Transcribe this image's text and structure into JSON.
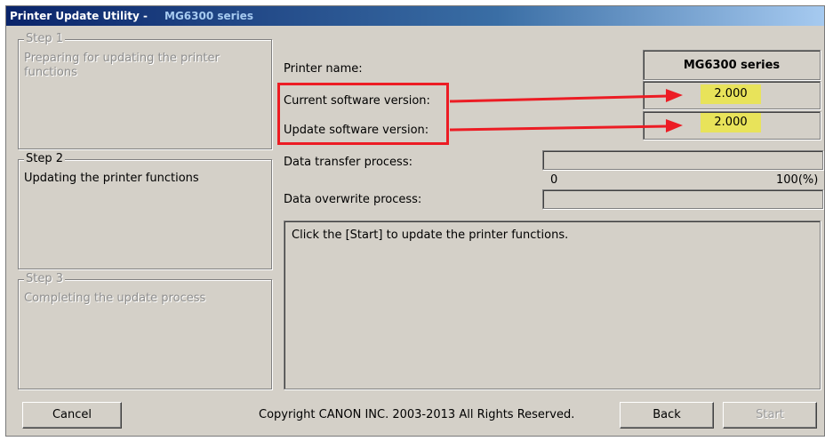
{
  "window": {
    "title": "Printer Update Utility -",
    "title_series": "MG6300 series"
  },
  "steps": [
    {
      "title": "Step 1",
      "desc": "Preparing for updating the printer functions",
      "active": false
    },
    {
      "title": "Step 2",
      "desc": "Updating the printer functions",
      "active": true
    },
    {
      "title": "Step 3",
      "desc": "Completing the update process",
      "active": false
    }
  ],
  "info": {
    "printer_name_label": "Printer name:",
    "printer_name_value": "MG6300 series",
    "current_version_label": "Current software version:",
    "current_version_value": "2.000",
    "update_version_label": "Update software version:",
    "update_version_value": "2.000"
  },
  "progress": {
    "transfer_label": "Data transfer process:",
    "overwrite_label": "Data overwrite process:",
    "scale_min": "0",
    "scale_max": "100(%)",
    "transfer_value": 0,
    "overwrite_value": 0
  },
  "message": "Click the [Start] to update the printer functions.",
  "footer": {
    "cancel_label": "Cancel",
    "copyright": "Copyright CANON INC. 2003-2013 All Rights Reserved.",
    "back_label": "Back",
    "start_label": "Start"
  },
  "colors": {
    "annotation_red": "#ec1c24",
    "highlight_yellow": "#e8e35a",
    "titlebar": "#0a246a"
  }
}
